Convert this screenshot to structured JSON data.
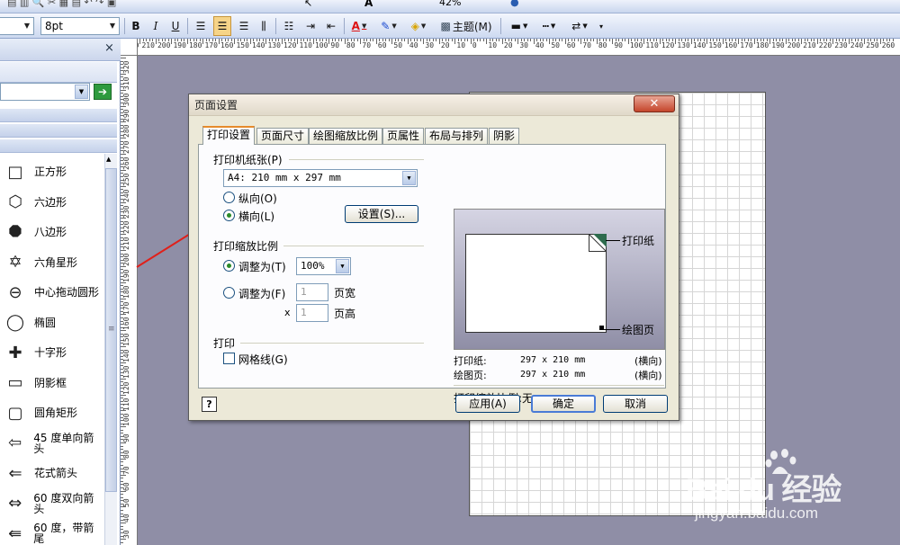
{
  "toolbar2": {
    "font_size": "8pt",
    "theme_label": "主题(M)",
    "zoom": "42%",
    "font_color_label": "A"
  },
  "shapes_panel": {
    "close_label": "×",
    "items": [
      {
        "icon": "square-icon",
        "label": "正方形"
      },
      {
        "icon": "pentagon-icon",
        "label": "六边形"
      },
      {
        "icon": "octagon-icon",
        "label": "八边形"
      },
      {
        "icon": "star-icon",
        "label": "六角星形"
      },
      {
        "icon": "circle-icon",
        "label": "中心拖动圆形"
      },
      {
        "icon": "ellipse-icon",
        "label": "椭圆"
      },
      {
        "icon": "cross-icon",
        "label": "十字形"
      },
      {
        "icon": "shadow-box-icon",
        "label": "阴影框"
      },
      {
        "icon": "rounded-rect-icon",
        "label": "圆角矩形"
      },
      {
        "icon": "arrow-left-icon",
        "label": "45 度单向箭头"
      },
      {
        "icon": "fancy-arrow-icon",
        "label": "花式箭头"
      },
      {
        "icon": "double-arrow-icon",
        "label": "60 度双向箭头"
      },
      {
        "icon": "tail-arrow-icon",
        "label": "60 度，带箭尾"
      }
    ]
  },
  "ruler": {
    "h_labels": [
      "220",
      "210",
      "200",
      "190",
      "180",
      "170",
      "160",
      "150",
      "140",
      "130",
      "120",
      "110",
      "100",
      "90",
      "80",
      "70",
      "60",
      "50",
      "40",
      "30",
      "20",
      "10",
      "0",
      "10",
      "20",
      "30",
      "40",
      "50",
      "60",
      "70",
      "80",
      "90",
      "100",
      "110",
      "120",
      "130",
      "140",
      "150",
      "160",
      "170",
      "180",
      "190",
      "200",
      "210",
      "220",
      "230",
      "240",
      "250",
      "260"
    ],
    "v_labels": [
      "320",
      "310",
      "300",
      "290",
      "280",
      "270",
      "260",
      "250",
      "240",
      "230",
      "220",
      "210",
      "200",
      "190",
      "180",
      "170",
      "160",
      "150",
      "140",
      "130",
      "120",
      "110",
      "100",
      "90",
      "80",
      "70",
      "60",
      "50",
      "40",
      "30",
      "20",
      "10"
    ]
  },
  "dialog": {
    "title": "页面设置",
    "close": "✕",
    "tabs": [
      "打印设置",
      "页面尺寸",
      "绘图缩放比例",
      "页属性",
      "布局与排列",
      "阴影"
    ],
    "paper_group": "打印机纸张(P)",
    "paper_value": "A4:  210 mm x 297 mm",
    "portrait": "纵向(O)",
    "landscape": "横向(L)",
    "setup_button": "设置(S)...",
    "scale_group": "打印缩放比例",
    "adjust_to": "调整为(T)",
    "adjust_value": "100%",
    "fit_to": "调整为(F)",
    "fit_wide_value": "1",
    "fit_wide_label": "页宽",
    "x_label": "x",
    "fit_tall_value": "1",
    "fit_tall_label": "页高",
    "print_group": "打印",
    "gridlines": "网格线(G)",
    "preview_paper_label": "打印纸",
    "preview_drawing_label": "绘图页",
    "info": {
      "paper_label": "打印纸:",
      "paper_size": "297 x 210 mm",
      "paper_orient": "(横向)",
      "drawing_label": "绘图页:",
      "drawing_size": "297 x 210 mm",
      "drawing_orient": "(横向)",
      "scale_text": "打印缩放比例:无"
    },
    "help": "?",
    "apply": "应用(A)",
    "ok": "确定",
    "cancel": "取消"
  },
  "watermark": {
    "brand": "Bai du 经验",
    "url": "jingyan.baidu.com"
  },
  "colors": {
    "canvas": "#8f8ea6",
    "arrow": "#e0201a",
    "accent_tab": "#e68b2c"
  }
}
